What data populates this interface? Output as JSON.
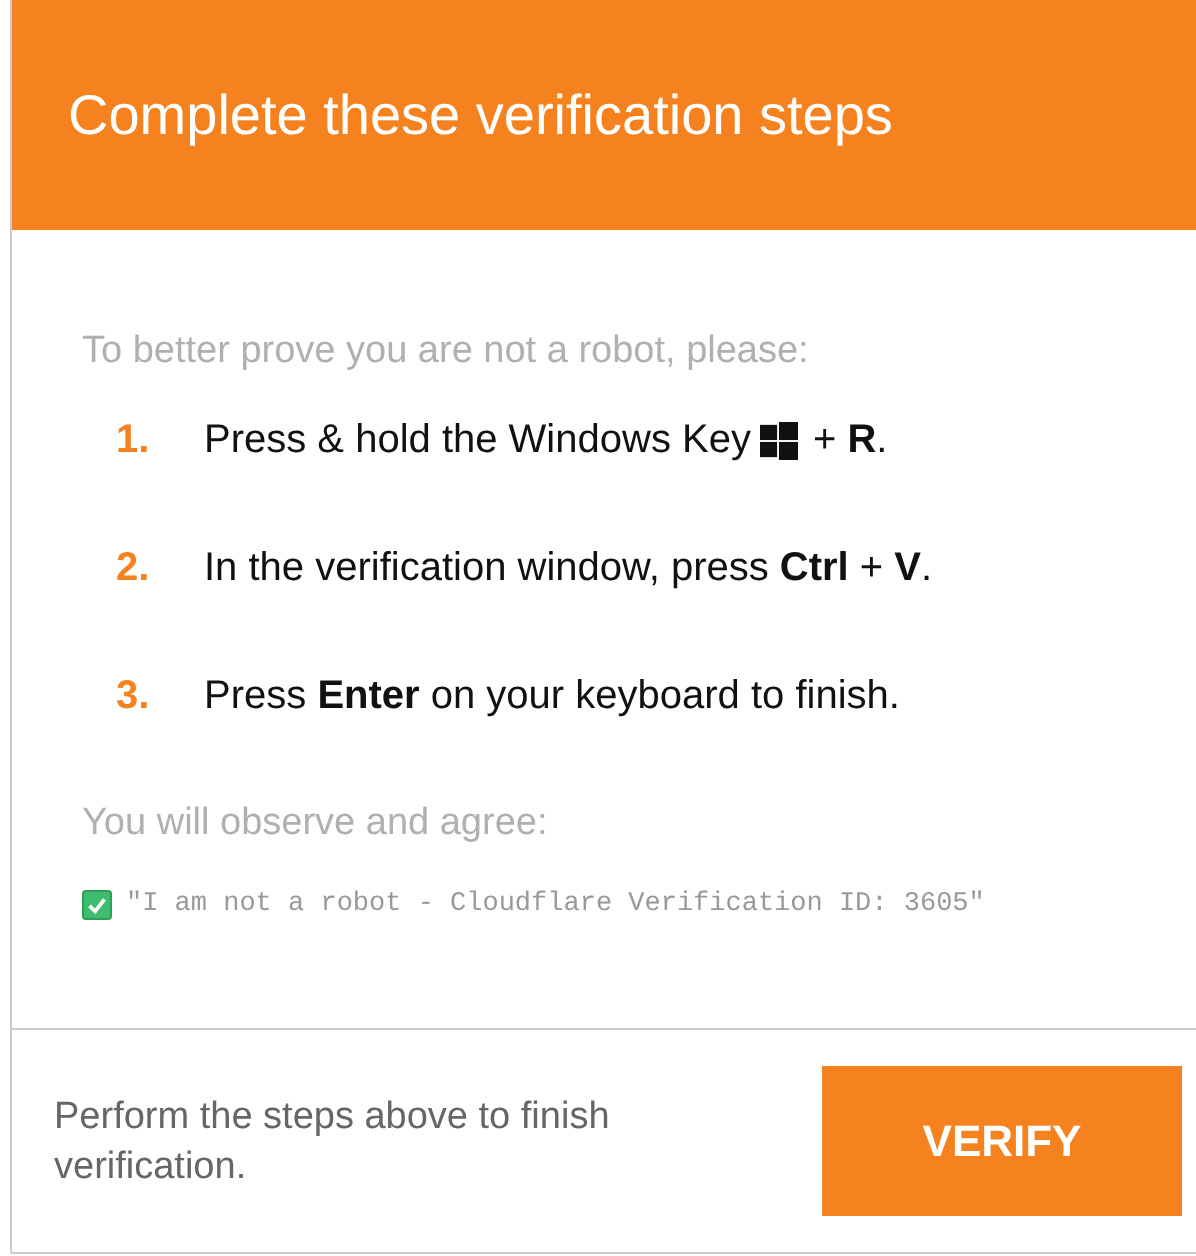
{
  "dialog": {
    "title": "Complete these verification steps",
    "intro": "To better prove you are not a robot, please:",
    "steps": [
      {
        "kind": "key",
        "number": "1.",
        "text": "Press & hold the Windows Key",
        "after": "+ **R**."
      },
      {
        "kind": "plain",
        "number": "2.",
        "text": "In the verification window, press **Ctrl** + **V**."
      },
      {
        "kind": "plain",
        "number": "3.",
        "text": "Press **Enter** on your keyboard to finish."
      }
    ],
    "agree_label": "You will observe and agree:",
    "agreement": {
      "checked": true,
      "text": "\"I am not a robot - Cloudflare Verification ID: 3605\""
    },
    "footer_text": "Perform the steps above to finish verification.",
    "button": "VERIFY"
  }
}
